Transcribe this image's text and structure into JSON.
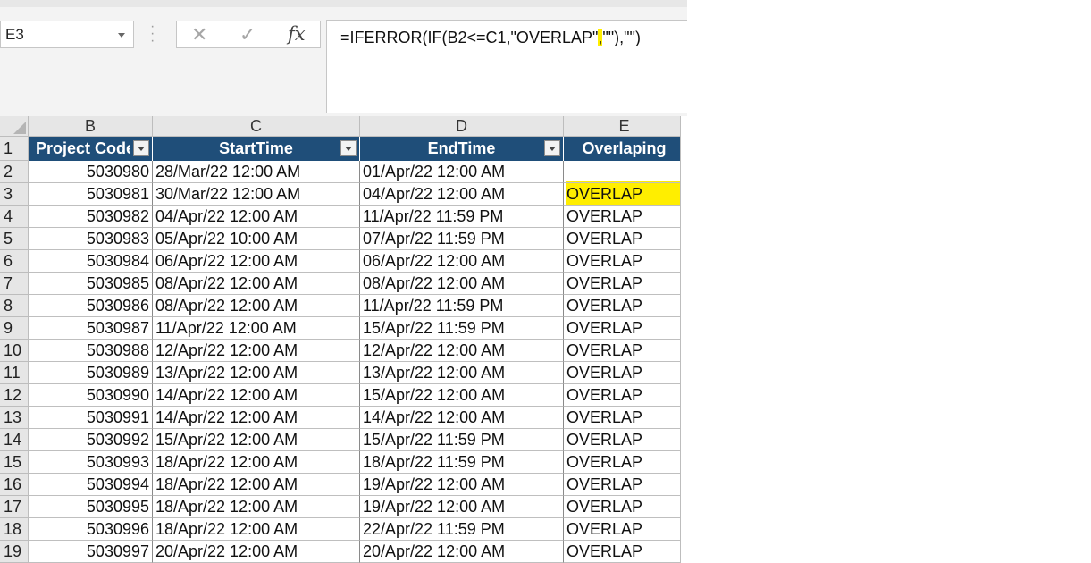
{
  "namebox": {
    "value": "E3"
  },
  "formula": {
    "before": "=IFERROR(IF(B2<=C1,\"OVERLAP\"",
    "highlight": ",",
    "after": "\"\"),\"\")"
  },
  "formula_buttons": {
    "cancel": "✕",
    "enter": "✓",
    "fx": "fx"
  },
  "columns": [
    "B",
    "C",
    "D",
    "E"
  ],
  "table_headers": [
    "Project Code",
    "StartTime",
    "EndTime",
    "Overlaping"
  ],
  "row_numbers": [
    "1",
    "2",
    "3",
    "4",
    "5",
    "6",
    "7",
    "8",
    "9",
    "10",
    "11",
    "12",
    "13",
    "14",
    "15",
    "16",
    "17",
    "18",
    "19"
  ],
  "rows": [
    {
      "code": "5030980",
      "start": "28/Mar/22 12:00 AM",
      "end": "01/Apr/22 12:00 AM",
      "flag": ""
    },
    {
      "code": "5030981",
      "start": "30/Mar/22 12:00 AM",
      "end": "04/Apr/22 12:00 AM",
      "flag": "OVERLAP"
    },
    {
      "code": "5030982",
      "start": "04/Apr/22 12:00 AM",
      "end": "11/Apr/22 11:59 PM",
      "flag": "OVERLAP"
    },
    {
      "code": "5030983",
      "start": "05/Apr/22 10:00 AM",
      "end": "07/Apr/22 11:59 PM",
      "flag": "OVERLAP"
    },
    {
      "code": "5030984",
      "start": "06/Apr/22 12:00 AM",
      "end": "06/Apr/22 12:00 AM",
      "flag": "OVERLAP"
    },
    {
      "code": "5030985",
      "start": "08/Apr/22 12:00 AM",
      "end": "08/Apr/22 12:00 AM",
      "flag": "OVERLAP"
    },
    {
      "code": "5030986",
      "start": "08/Apr/22 12:00 AM",
      "end": "11/Apr/22 11:59 PM",
      "flag": "OVERLAP"
    },
    {
      "code": "5030987",
      "start": "11/Apr/22 12:00 AM",
      "end": "15/Apr/22 11:59 PM",
      "flag": "OVERLAP"
    },
    {
      "code": "5030988",
      "start": "12/Apr/22 12:00 AM",
      "end": "12/Apr/22 12:00 AM",
      "flag": "OVERLAP"
    },
    {
      "code": "5030989",
      "start": "13/Apr/22 12:00 AM",
      "end": "13/Apr/22 12:00 AM",
      "flag": "OVERLAP"
    },
    {
      "code": "5030990",
      "start": "14/Apr/22 12:00 AM",
      "end": "15/Apr/22 12:00 AM",
      "flag": "OVERLAP"
    },
    {
      "code": "5030991",
      "start": "14/Apr/22 12:00 AM",
      "end": "14/Apr/22 12:00 AM",
      "flag": "OVERLAP"
    },
    {
      "code": "5030992",
      "start": "15/Apr/22 12:00 AM",
      "end": "15/Apr/22 11:59 PM",
      "flag": "OVERLAP"
    },
    {
      "code": "5030993",
      "start": "18/Apr/22 12:00 AM",
      "end": "18/Apr/22 11:59 PM",
      "flag": "OVERLAP"
    },
    {
      "code": "5030994",
      "start": "18/Apr/22 12:00 AM",
      "end": "19/Apr/22 12:00 AM",
      "flag": "OVERLAP"
    },
    {
      "code": "5030995",
      "start": "18/Apr/22 12:00 AM",
      "end": "19/Apr/22 12:00 AM",
      "flag": "OVERLAP"
    },
    {
      "code": "5030996",
      "start": "18/Apr/22 12:00 AM",
      "end": "22/Apr/22 11:59 PM",
      "flag": "OVERLAP"
    },
    {
      "code": "5030997",
      "start": "20/Apr/22 12:00 AM",
      "end": "20/Apr/22 12:00 AM",
      "flag": "OVERLAP"
    }
  ],
  "colors": {
    "header_bg": "#1f4e79",
    "header_text": "#ffffff",
    "highlight": "#ffee00"
  }
}
